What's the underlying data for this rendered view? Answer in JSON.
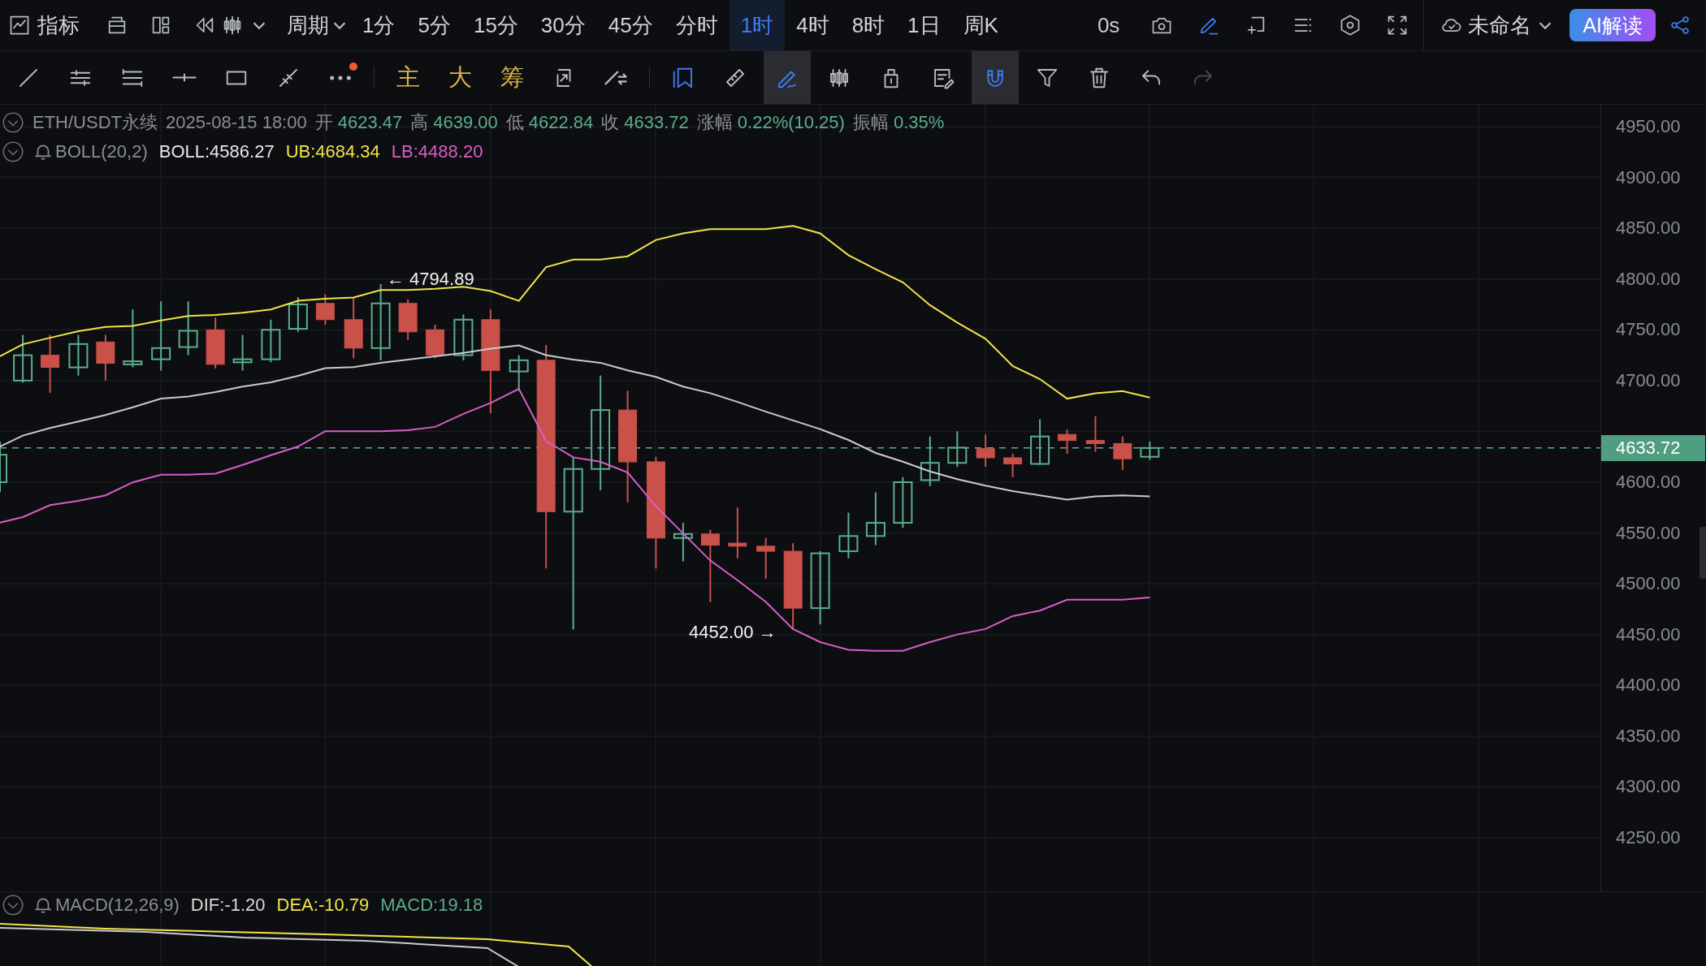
{
  "top_bar": {
    "indicator_label": "指标",
    "period_label": "周期",
    "periods": [
      {
        "label": "1分",
        "selected": false
      },
      {
        "label": "5分",
        "selected": false
      },
      {
        "label": "15分",
        "selected": false
      },
      {
        "label": "30分",
        "selected": false
      },
      {
        "label": "45分",
        "selected": false
      },
      {
        "label": "分时",
        "selected": false
      },
      {
        "label": "1时",
        "selected": true
      },
      {
        "label": "4时",
        "selected": false
      },
      {
        "label": "8时",
        "selected": false
      },
      {
        "label": "1日",
        "selected": false
      },
      {
        "label": "周K",
        "selected": false
      }
    ],
    "timer": "0s",
    "layout_name": "未命名",
    "ai_button": "AI解读"
  },
  "tool_groups": [
    {
      "tools": [
        {
          "kind": "icon",
          "selected": false,
          "active": false,
          "disabled": false,
          "badge": false
        },
        {
          "kind": "icon",
          "selected": false,
          "active": false,
          "disabled": false,
          "badge": false
        },
        {
          "kind": "icon",
          "selected": false,
          "active": false,
          "disabled": false,
          "badge": false
        },
        {
          "kind": "icon",
          "selected": false,
          "active": false,
          "disabled": false,
          "badge": false
        },
        {
          "kind": "icon",
          "selected": false,
          "active": false,
          "disabled": false,
          "badge": false
        },
        {
          "kind": "icon",
          "selected": false,
          "active": false,
          "disabled": false,
          "badge": false
        },
        {
          "kind": "icon",
          "selected": false,
          "active": false,
          "disabled": false,
          "badge": true
        }
      ]
    },
    {
      "tools": [
        {
          "kind": "text",
          "label": "主",
          "selected": false,
          "active": false,
          "disabled": false,
          "badge": false
        },
        {
          "kind": "text",
          "label": "大",
          "selected": false,
          "active": false,
          "disabled": false,
          "badge": false
        },
        {
          "kind": "text",
          "label": "筹",
          "selected": false,
          "active": false,
          "disabled": false,
          "badge": false
        },
        {
          "kind": "icon",
          "selected": false,
          "active": false,
          "disabled": false,
          "badge": false
        },
        {
          "kind": "icon",
          "selected": false,
          "active": false,
          "disabled": false,
          "badge": false
        }
      ]
    },
    {
      "tools": [
        {
          "kind": "icon",
          "selected": false,
          "active": true,
          "disabled": false,
          "badge": false
        },
        {
          "kind": "icon",
          "selected": false,
          "active": false,
          "disabled": false,
          "badge": false
        },
        {
          "kind": "icon",
          "selected": true,
          "active": true,
          "disabled": false,
          "badge": false
        },
        {
          "kind": "icon",
          "selected": false,
          "active": false,
          "disabled": false,
          "badge": false
        },
        {
          "kind": "icon",
          "selected": false,
          "active": false,
          "disabled": false,
          "badge": false
        },
        {
          "kind": "icon",
          "selected": false,
          "active": false,
          "disabled": false,
          "badge": false
        },
        {
          "kind": "icon",
          "selected": true,
          "active": true,
          "disabled": false,
          "badge": false
        },
        {
          "kind": "icon",
          "selected": false,
          "active": false,
          "disabled": false,
          "badge": false
        },
        {
          "kind": "icon",
          "selected": false,
          "active": false,
          "disabled": false,
          "badge": false
        },
        {
          "kind": "icon",
          "selected": false,
          "active": false,
          "disabled": false,
          "badge": false
        },
        {
          "kind": "icon",
          "selected": false,
          "active": false,
          "disabled": true,
          "badge": false
        }
      ]
    }
  ],
  "legend": {
    "symbol": "ETH/USDT永续",
    "time": "2025-08-15 18:00",
    "fields": [
      {
        "label": "开",
        "value": "4623.47"
      },
      {
        "label": "高",
        "value": "4639.00"
      },
      {
        "label": "低",
        "value": "4622.84"
      },
      {
        "label": "收",
        "value": "4633.72"
      },
      {
        "label": "涨幅",
        "value": "0.22%(10.25)"
      },
      {
        "label": "振幅",
        "value": "0.35%"
      }
    ]
  },
  "boll": {
    "name": "BOLL(20,2)",
    "values": [
      {
        "text": "BOLL:4586.27",
        "color": "#e8e8e8"
      },
      {
        "text": "UB:4684.34",
        "color": "#f2e34a"
      },
      {
        "text": "LB:4488.20",
        "color": "#d85ec8"
      }
    ]
  },
  "price_axis": [
    "4950.00",
    "4900.00",
    "4850.00",
    "4800.00",
    "4750.00",
    "4700.00",
    "4600.00",
    "4550.00",
    "4500.00",
    "4450.00",
    "4400.00",
    "4350.00",
    "4300.00",
    "4250.00"
  ],
  "last_price": "4633.72",
  "high_marker": "← 4794.89",
  "low_marker": "4452.00 →",
  "macd": {
    "name": "MACD(12,26,9)",
    "values": [
      {
        "text": "DIF:-1.20",
        "color": "#d8d8d8"
      },
      {
        "text": "DEA:-10.79",
        "color": "#f2e34a"
      },
      {
        "text": "MACD:19.18",
        "color": "#5aae8f"
      }
    ]
  }
}
